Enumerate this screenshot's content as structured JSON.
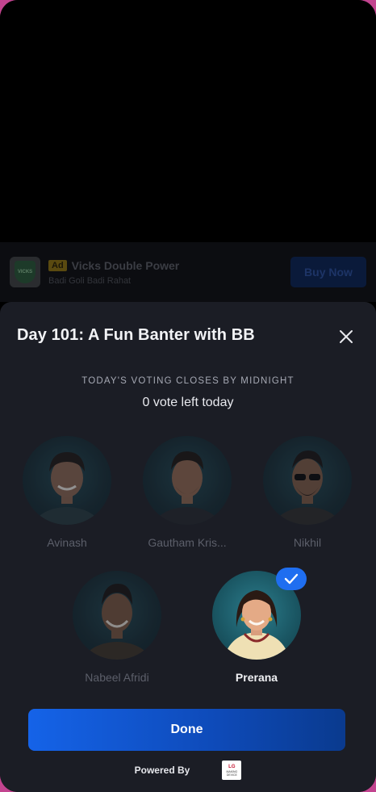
{
  "ad": {
    "badge": "Ad",
    "title": "Vicks Double Power",
    "subtitle": "Badi Goli Badi Rahat",
    "logo_text": "VICKS",
    "cta": "Buy Now"
  },
  "sheet": {
    "title": "Day 101: A Fun Banter with BB",
    "deadline": "TODAY'S VOTING CLOSES BY MIDNIGHT",
    "votes_left": "0 vote left today"
  },
  "candidates": [
    {
      "name": "Avinash",
      "selected": false
    },
    {
      "name": "Gautham Kris...",
      "selected": false
    },
    {
      "name": "Nikhil",
      "selected": false
    },
    {
      "name": "Nabeel Afridi",
      "selected": false
    },
    {
      "name": "Prerana",
      "selected": true
    }
  ],
  "actions": {
    "done_label": "Done"
  },
  "footer": {
    "powered_by": "Powered By",
    "sponsor_logo_text": "LG",
    "sponsor_tagline": "MAKING DEVICE"
  },
  "colors": {
    "sheet_bg": "#1b1d25",
    "accent": "#1f6ef0",
    "frame": "#c2448f"
  }
}
